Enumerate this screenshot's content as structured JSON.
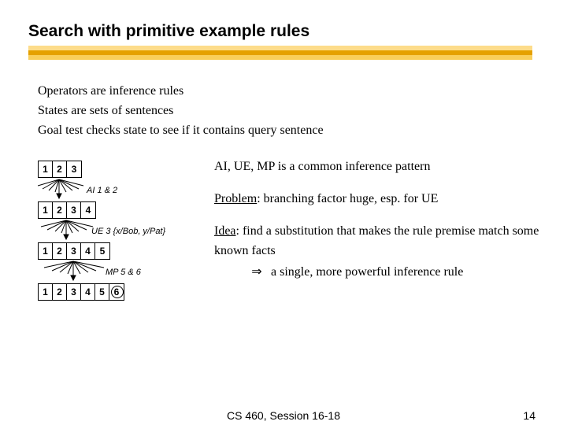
{
  "title": "Search with primitive example rules",
  "intro": {
    "l1": "Operators are inference rules",
    "l2": "States are sets of sentences",
    "l3": "Goal test checks state to see if it contains query sentence"
  },
  "diagram": {
    "states": [
      {
        "cells": [
          "1",
          "2",
          "3"
        ],
        "circled": -1
      },
      {
        "cells": [
          "1",
          "2",
          "3",
          "4"
        ],
        "circled": -1
      },
      {
        "cells": [
          "1",
          "2",
          "3",
          "4",
          "5"
        ],
        "circled": -1
      },
      {
        "cells": [
          "1",
          "2",
          "3",
          "4",
          "5",
          "6"
        ],
        "circled": 5
      }
    ],
    "steps": [
      "AI 1 & 2",
      "UE 3 {x/Bob, y/Pat}",
      "MP 5 & 6"
    ]
  },
  "right": {
    "p1": "AI, UE, MP is a common inference pattern",
    "p2_label": "Problem",
    "p2_rest": ": branching factor huge, esp. for UE",
    "p3_label": "Idea",
    "p3_rest": ": find a substitution that makes the rule premise match some known facts",
    "p3_tail": " a single, more powerful inference rule",
    "arrow": "⇒"
  },
  "footer": {
    "center": "CS 460,  Session 16-18",
    "page": "14"
  }
}
